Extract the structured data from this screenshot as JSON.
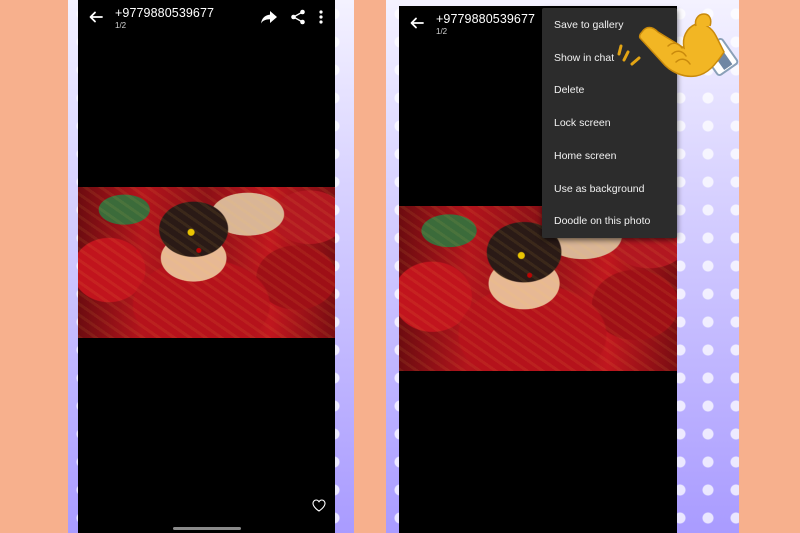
{
  "left_screen": {
    "title": "+9779880539677",
    "subtitle": "1/2",
    "icons": {
      "back": "back-arrow-icon",
      "forward": "forward-icon",
      "share": "share-icon",
      "more": "more-vert-icon",
      "favorite": "heart-icon"
    }
  },
  "right_screen": {
    "title": "+9779880539677",
    "subtitle": "1/2",
    "menu": {
      "items": [
        "Save to gallery",
        "Show in chat",
        "Delete",
        "Lock screen",
        "Home screen",
        "Use as background",
        "Doodle on this photo"
      ]
    }
  },
  "colors": {
    "page_background": "#f7b08d",
    "menu_background": "#2c2c2c",
    "hand_pointer": "#f0b429"
  }
}
